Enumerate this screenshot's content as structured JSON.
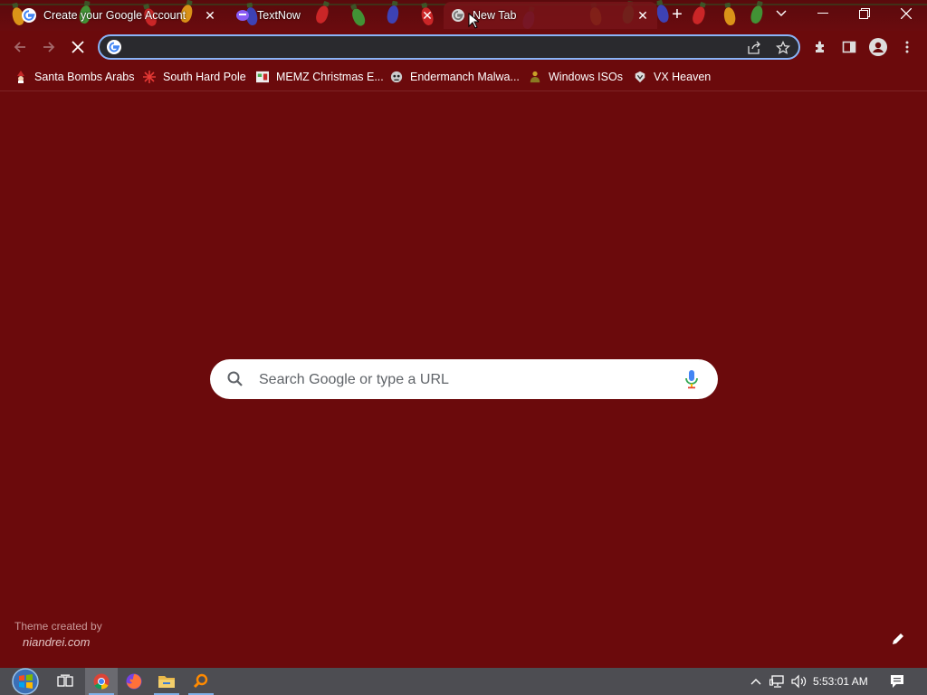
{
  "tabs": [
    {
      "title": "Create your Google Account",
      "favicon": "google-icon"
    },
    {
      "title": "TextNow",
      "favicon": "textnow-icon"
    },
    {
      "title": "New Tab",
      "favicon": "google-icon",
      "active": true
    }
  ],
  "tab_close_glyph": "✕",
  "new_tab_glyph": "+",
  "window_controls": {
    "tab_search": "⌄",
    "minimize": "—",
    "restore": "❐",
    "close": "✕"
  },
  "toolbar": {
    "address_value": "",
    "icons": [
      "back-icon",
      "forward-icon",
      "stop-loading-icon",
      "share-icon",
      "star-icon",
      "extensions-icon",
      "side-panel-icon",
      "profile-icon",
      "menu-icon"
    ]
  },
  "bookmarks": [
    {
      "label": "Santa Bombs Arabs",
      "icon": "santa-icon"
    },
    {
      "label": "South Hard Pole",
      "icon": "snowflake-icon"
    },
    {
      "label": "MEMZ Christmas E...",
      "icon": "memz-icon"
    },
    {
      "label": "Endermanch Malwa...",
      "icon": "endermanch-icon"
    },
    {
      "label": "Windows ISOs",
      "icon": "buddha-icon"
    },
    {
      "label": "VX Heaven",
      "icon": "vx-heaven-icon"
    }
  ],
  "ntp": {
    "search_placeholder": "Search Google or type a URL",
    "theme_credit_line1": "Theme created by",
    "theme_credit_line2": "niandrei.com"
  },
  "taskbar": {
    "apps": [
      "start-orb",
      "task-view",
      "chrome",
      "firefox",
      "file-explorer",
      "search-app"
    ],
    "time": "5:53:01 AM"
  },
  "colors": {
    "background": "#6b0a0c",
    "omnibox_border": "#8ab4f8",
    "omnibox_bg": "#2a2a2e",
    "taskbar": "#4d4d52"
  }
}
